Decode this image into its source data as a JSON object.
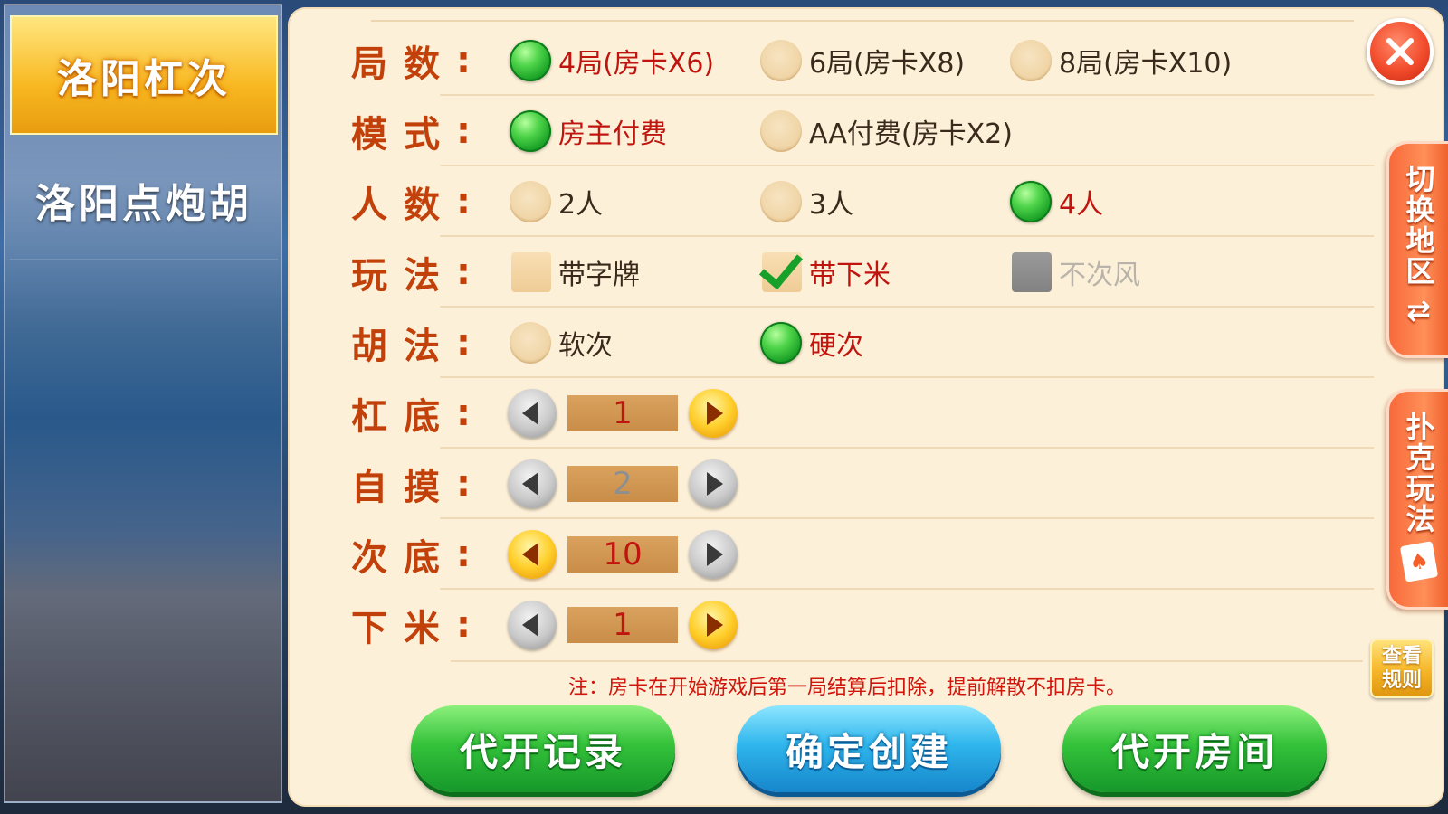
{
  "sidebar": {
    "items": [
      {
        "label": "洛阳杠次",
        "active": true
      },
      {
        "label": "洛阳点炮胡",
        "active": false
      }
    ]
  },
  "settings": {
    "rows": [
      {
        "label": [
          "局",
          "数",
          ":"
        ],
        "options": [
          {
            "text": "4局(房卡X6)",
            "type": "radio",
            "selected": true
          },
          {
            "text": "6局(房卡X8)",
            "type": "radio",
            "selected": false
          },
          {
            "text": "8局(房卡X10)",
            "type": "radio",
            "selected": false
          }
        ]
      },
      {
        "label": [
          "模",
          "式",
          ":"
        ],
        "options": [
          {
            "text": "房主付费",
            "type": "radio",
            "selected": true
          },
          {
            "text": "AA付费(房卡X2)",
            "type": "radio",
            "selected": false
          }
        ]
      },
      {
        "label": [
          "人",
          "数",
          ":"
        ],
        "options": [
          {
            "text": "2人",
            "type": "radio",
            "selected": false
          },
          {
            "text": "3人",
            "type": "radio",
            "selected": false
          },
          {
            "text": "4人",
            "type": "radio",
            "selected": true
          }
        ]
      },
      {
        "label": [
          "玩",
          "法",
          ":"
        ],
        "options": [
          {
            "text": "带字牌",
            "type": "checkbox",
            "selected": false
          },
          {
            "text": "带下米",
            "type": "checkbox",
            "selected": true
          },
          {
            "text": "不次风",
            "type": "checkbox",
            "selected": false,
            "disabled": true
          }
        ]
      },
      {
        "label": [
          "胡",
          "法",
          ":"
        ],
        "options": [
          {
            "text": "软次",
            "type": "radio",
            "selected": false
          },
          {
            "text": "硬次",
            "type": "radio",
            "selected": true
          }
        ]
      }
    ],
    "steppers": [
      {
        "label": [
          "杠",
          "底",
          ":"
        ],
        "value": "1",
        "dim": false,
        "left_active": false,
        "right_active": true
      },
      {
        "label": [
          "自",
          "摸",
          ":"
        ],
        "value": "2",
        "dim": true,
        "left_active": false,
        "right_active": false
      },
      {
        "label": [
          "次",
          "底",
          ":"
        ],
        "value": "10",
        "dim": false,
        "left_active": true,
        "right_active": false
      },
      {
        "label": [
          "下",
          "米",
          ":"
        ],
        "value": "1",
        "dim": false,
        "left_active": false,
        "right_active": true
      }
    ]
  },
  "note": "注：房卡在开始游戏后第一局结算后扣除，提前解散不扣房卡。",
  "buttons": {
    "history": "代开记录",
    "create": "确定创建",
    "proxy_room": "代开房间"
  },
  "side_tabs": {
    "switch_region": "切换地区",
    "switch_icon": "⇄",
    "poker_rules": "扑克玩法",
    "card_icon": "♠",
    "view_rules_line1": "查看",
    "view_rules_line2": "规则"
  },
  "colors": {
    "label": "#c2400a",
    "selected_text": "#c0140e",
    "panel_bg": "#fdf0d8",
    "active_tab": "#f8b820"
  }
}
